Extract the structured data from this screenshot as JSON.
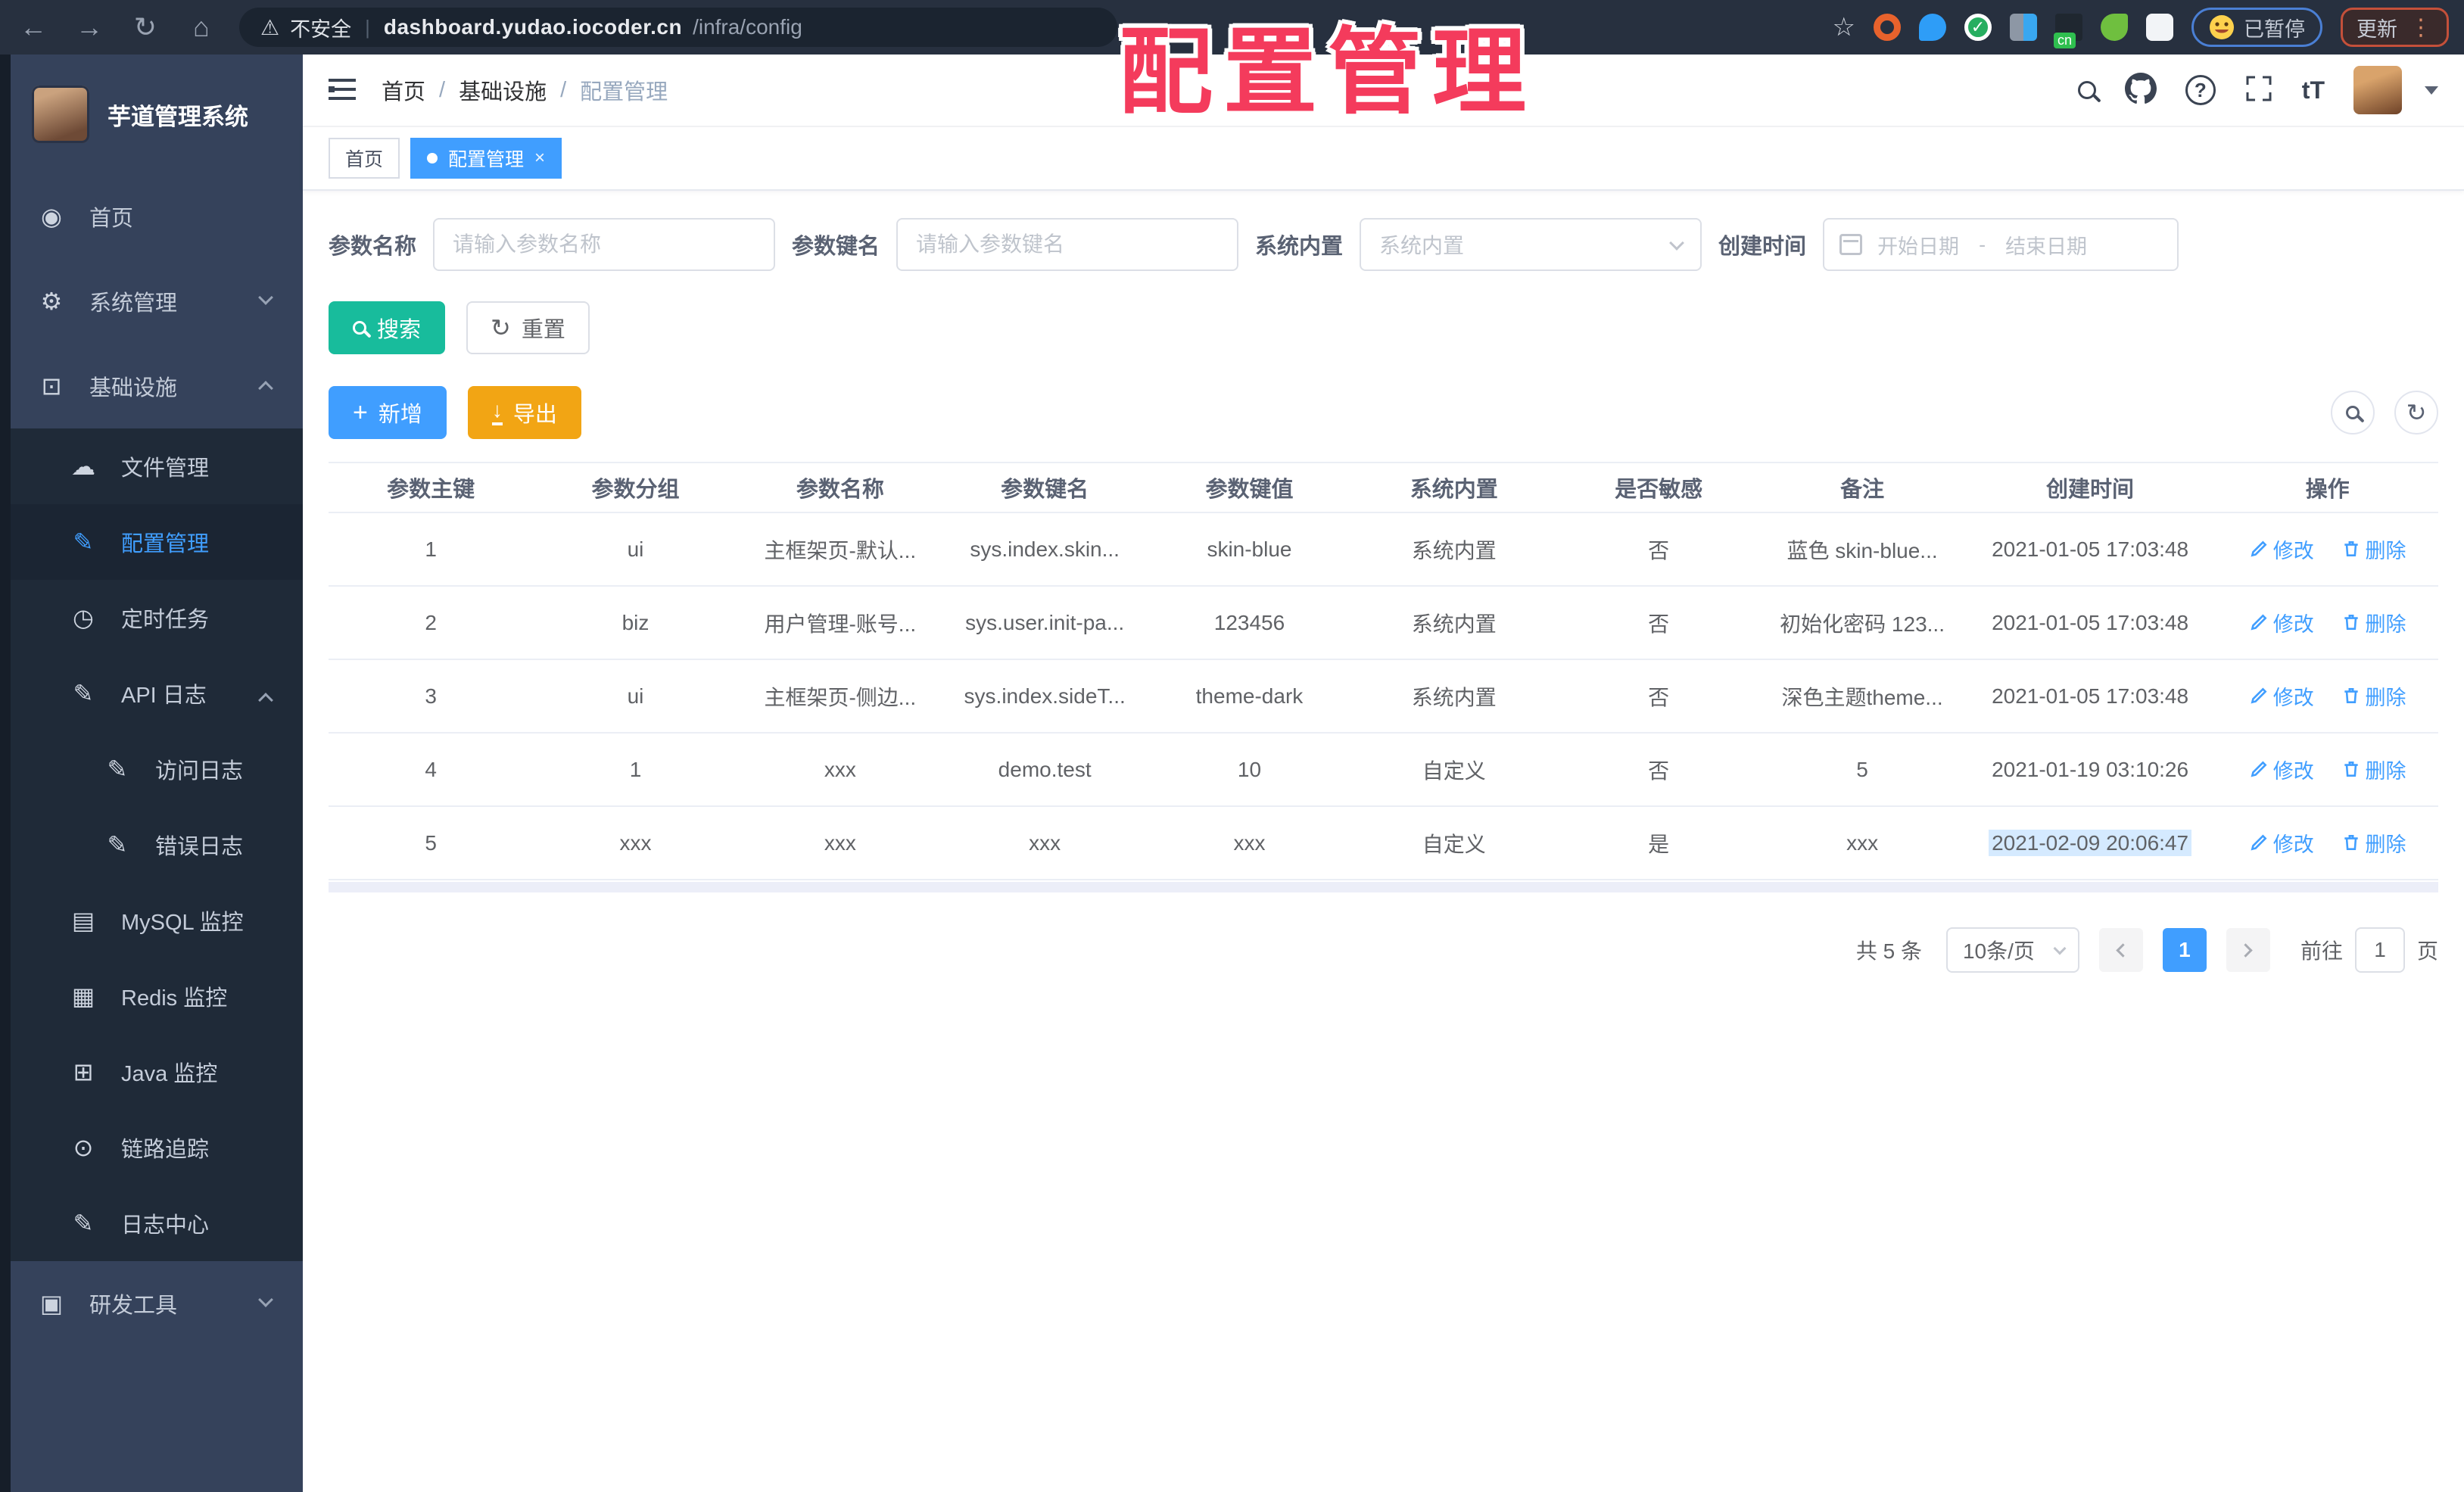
{
  "overlay": {
    "title": "配置管理"
  },
  "colors": {
    "accent": "#409eff",
    "search_teal": "#18bc9c",
    "export_orange": "#f2a514",
    "overlay_pink": "#f43b5c",
    "sidebar_bg": "#35425b",
    "submenu_bg": "#1f2a38",
    "chrome_bg": "#27303f"
  },
  "browser": {
    "security_label": "不安全",
    "url_host": "dashboard.yudao.iocoder.cn",
    "url_path": "/infra/config",
    "paused_label": "已暂停",
    "update_label": "更新",
    "kebab": "⋮",
    "back": "←",
    "forward": "→",
    "reload": "↻",
    "home": "⌂",
    "warning": "⚠",
    "star": "☆"
  },
  "sidebar": {
    "app_title": "芋道管理系统",
    "items": [
      {
        "label": "首页",
        "icon": "◉"
      },
      {
        "label": "系统管理",
        "icon": "⚙"
      },
      {
        "label": "基础设施",
        "icon": "⊡"
      }
    ],
    "infra_children": [
      {
        "label": "文件管理",
        "icon": "☁"
      },
      {
        "label": "配置管理",
        "icon": "✎"
      },
      {
        "label": "定时任务",
        "icon": "◷"
      },
      {
        "label": "API 日志",
        "icon": "✎"
      },
      {
        "label": "访问日志",
        "icon": "✎"
      },
      {
        "label": "错误日志",
        "icon": "✎"
      },
      {
        "label": "MySQL 监控",
        "icon": "▤"
      },
      {
        "label": "Redis 监控",
        "icon": "▦"
      },
      {
        "label": "Java 监控",
        "icon": "⊞"
      },
      {
        "label": "链路追踪",
        "icon": "⊙"
      },
      {
        "label": "日志中心",
        "icon": "✎"
      }
    ],
    "dev_tools": {
      "label": "研发工具",
      "icon": "▣"
    }
  },
  "header": {
    "breadcrumb": [
      "首页",
      "基础设施",
      "配置管理"
    ],
    "separator": "/",
    "font_icon": "tT",
    "help_icon": "?"
  },
  "tabs": [
    {
      "label": "首页"
    },
    {
      "label": "配置管理",
      "close": "×"
    }
  ],
  "filters": {
    "name_label": "参数名称",
    "name_placeholder": "请输入参数名称",
    "key_label": "参数键名",
    "key_placeholder": "请输入参数键名",
    "type_label": "系统内置",
    "type_placeholder": "系统内置",
    "time_label": "创建时间",
    "start_placeholder": "开始日期",
    "range_separator": "-",
    "end_placeholder": "结束日期",
    "search_label": "搜索",
    "reset_label": "重置",
    "reset_icon": "↻"
  },
  "toolbar": {
    "add_label": "新增",
    "add_icon": "+",
    "export_label": "导出",
    "export_icon": "↓",
    "refresh_icon": "↻"
  },
  "table": {
    "columns": [
      "参数主键",
      "参数分组",
      "参数名称",
      "参数键名",
      "参数键值",
      "系统内置",
      "是否敏感",
      "备注",
      "创建时间",
      "操作"
    ],
    "edit_label": "修改",
    "delete_label": "删除",
    "rows": [
      {
        "id": "1",
        "group": "ui",
        "name": "主框架页-默认...",
        "key": "sys.index.skin...",
        "value": "skin-blue",
        "type": "系统内置",
        "sensitive": "否",
        "remark": "蓝色 skin-blue...",
        "created": "2021-01-05 17:03:48"
      },
      {
        "id": "2",
        "group": "biz",
        "name": "用户管理-账号...",
        "key": "sys.user.init-pa...",
        "value": "123456",
        "type": "系统内置",
        "sensitive": "否",
        "remark": "初始化密码 123...",
        "created": "2021-01-05 17:03:48"
      },
      {
        "id": "3",
        "group": "ui",
        "name": "主框架页-侧边...",
        "key": "sys.index.sideT...",
        "value": "theme-dark",
        "type": "系统内置",
        "sensitive": "否",
        "remark": "深色主题theme...",
        "created": "2021-01-05 17:03:48"
      },
      {
        "id": "4",
        "group": "1",
        "name": "xxx",
        "key": "demo.test",
        "value": "10",
        "type": "自定义",
        "sensitive": "否",
        "remark": "5",
        "created": "2021-01-19 03:10:26"
      },
      {
        "id": "5",
        "group": "xxx",
        "name": "xxx",
        "key": "xxx",
        "value": "xxx",
        "type": "自定义",
        "sensitive": "是",
        "remark": "xxx",
        "created": "2021-02-09 20:06:47"
      }
    ]
  },
  "pagination": {
    "total_label": "共 5 条",
    "page_size": "10条/页",
    "current_page": "1",
    "goto_label": "前往",
    "goto_value": "1",
    "page_suffix": "页"
  }
}
